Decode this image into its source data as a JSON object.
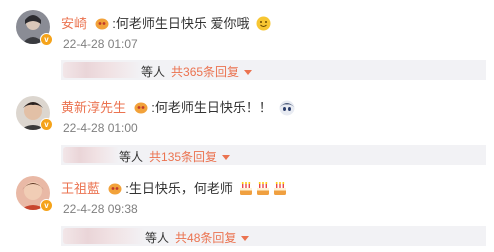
{
  "comments": [
    {
      "username": "安崎",
      "text": ":何老师生日快乐 爱你哦",
      "timestamp": "22-4-28 01:07",
      "reply_others": "等人",
      "reply_count": "共365条回复",
      "trailing_emoji": "smiley-face"
    },
    {
      "username": "黄新淳先生",
      "text": ":何老师生日快乐！！",
      "timestamp": "22-4-28 01:00",
      "reply_others": "等人",
      "reply_count": "共135条回复",
      "trailing_emoji": "anime-face"
    },
    {
      "username": "王祖藍",
      "text": ":生日快乐，何老师",
      "timestamp": "22-4-28 09:38",
      "reply_others": "等人",
      "reply_count": "共48条回复",
      "trailing_emoji": "birthday-cake"
    }
  ],
  "colors": {
    "username": "#eb7350",
    "reply_count": "#eb7350",
    "timestamp": "#808080",
    "reply_bg": "#f2f2f5",
    "verified_badge": "#f5a31a"
  }
}
